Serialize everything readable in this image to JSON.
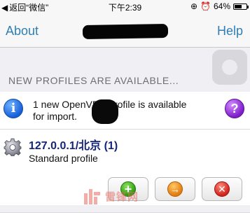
{
  "status_bar": {
    "back_label": "返回“微信”",
    "time": "下午2:39",
    "battery_percent": "64%",
    "battery_level": 0.64
  },
  "nav": {
    "about_label": "About",
    "help_label": "Help"
  },
  "section": {
    "title": "NEW PROFILES ARE AVAILABLE..."
  },
  "notice": {
    "info_symbol": "i",
    "help_symbol": "?",
    "line1": "1 new OpenVPN profile is available",
    "line2": "for import."
  },
  "profile": {
    "name": "127.0.0.1/北京 (1)",
    "subtitle": "Standard profile"
  },
  "actions": {
    "add_symbol": "+",
    "import_symbol": "→",
    "delete_symbol": "✕",
    "add_color": "#2a9a11",
    "import_color": "#e37a0c",
    "delete_color": "#d0231c"
  },
  "watermark": {
    "text": "雷锋网"
  },
  "colors": {
    "nav_tint": "#2f7fb5",
    "profile_name": "#15267a"
  }
}
